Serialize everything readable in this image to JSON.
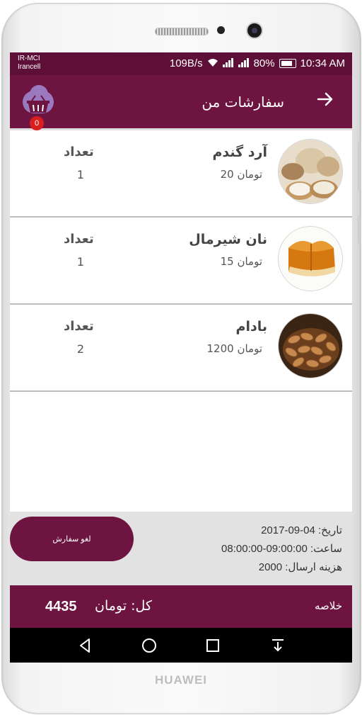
{
  "device": {
    "brand": "HUAWEI"
  },
  "status_bar": {
    "carrier_line1": "IR-MCI",
    "carrier_line2": "Irancell",
    "speed": "109B/s",
    "battery": "80%",
    "time": "10:34 AM",
    "net1": "2G",
    "net2": "4G"
  },
  "toolbar": {
    "title": "سفارشات من",
    "back_icon": "arrow-right-icon",
    "cart_badge": "0"
  },
  "items": [
    {
      "name": "آرد گندم",
      "price_num": "20",
      "price_unit": "تومان",
      "qty_label": "تعداد",
      "qty": "1",
      "image": "flour-icon"
    },
    {
      "name": "نان شیرمال",
      "price_num": "15",
      "price_unit": "تومان",
      "qty_label": "تعداد",
      "qty": "1",
      "image": "bread-icon"
    },
    {
      "name": "بادام",
      "price_num": "1200",
      "price_unit": "تومان",
      "qty_label": "تعداد",
      "qty": "2",
      "image": "almond-icon"
    }
  ],
  "summary": {
    "cancel_label": "لغو سفارش",
    "date_label": "تاریخ:",
    "date": "04-09-2017",
    "time_label": "ساعت:",
    "time": "09:00:00-08:00:00",
    "shipping_label": "هزینه ارسال:",
    "shipping": "2000"
  },
  "total": {
    "label": "کل: تومان",
    "amount": "4435",
    "summary_label": "خلاصه"
  },
  "colors": {
    "primary": "#6e1440",
    "status": "#5e0f37",
    "badge": "#d91f1f"
  }
}
